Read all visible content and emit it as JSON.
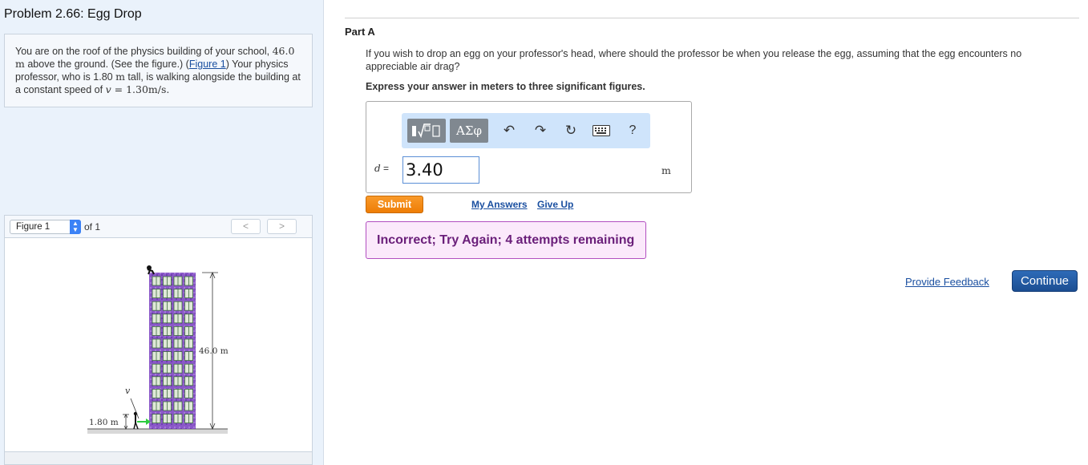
{
  "problem": {
    "title": "Problem 2.66: Egg Drop",
    "text_1": "You are on the roof of the physics building of your school, ",
    "height_val": "46.0",
    "unit_m": "m",
    "text_2": " above the ground. (See the figure.) (",
    "figure_link": "Figure 1",
    "text_3": ") Your physics professor, who is 1.80 ",
    "text_4": " tall, is walking alongside the building at a constant speed of ",
    "speed_var": "v",
    "speed_eq": " = 1.30m/s."
  },
  "figure": {
    "select_value": "Figure 1",
    "of_label": "of 1",
    "prev_icon": "chevron-left-icon",
    "next_icon": "chevron-right-icon",
    "height_label": "46.0 m",
    "prof_height_label": "1.80 m",
    "speed_label": "v"
  },
  "part": {
    "label": "Part A",
    "question": "If you wish to drop an egg on your professor's head, where should the professor be when you release the egg, assuming that the egg encounters no appreciable air drag?",
    "instruction": "Express your answer in meters to three significant figures."
  },
  "toolbar": {
    "template_icon": "template-icon",
    "greek_label": "ΑΣφ",
    "undo_icon": "undo-icon",
    "redo_icon": "redo-icon",
    "reset_icon": "reset-icon",
    "keyboard_icon": "keyboard-icon",
    "help_label": "?"
  },
  "answer": {
    "variable": "d",
    "equals": " =",
    "value": "3.40",
    "unit": "m"
  },
  "actions": {
    "submit": "Submit",
    "my_answers": "My Answers",
    "give_up": "Give Up",
    "feedback_message": "Incorrect; Try Again; 4 attempts remaining",
    "provide_feedback": "Provide Feedback",
    "continue": "Continue"
  },
  "colors": {
    "submit": "#ee7d06",
    "continue": "#1c4e92",
    "feedback_bg": "#fbe9fb",
    "feedback_text": "#6a1f7a",
    "building": "#8a58c8"
  }
}
